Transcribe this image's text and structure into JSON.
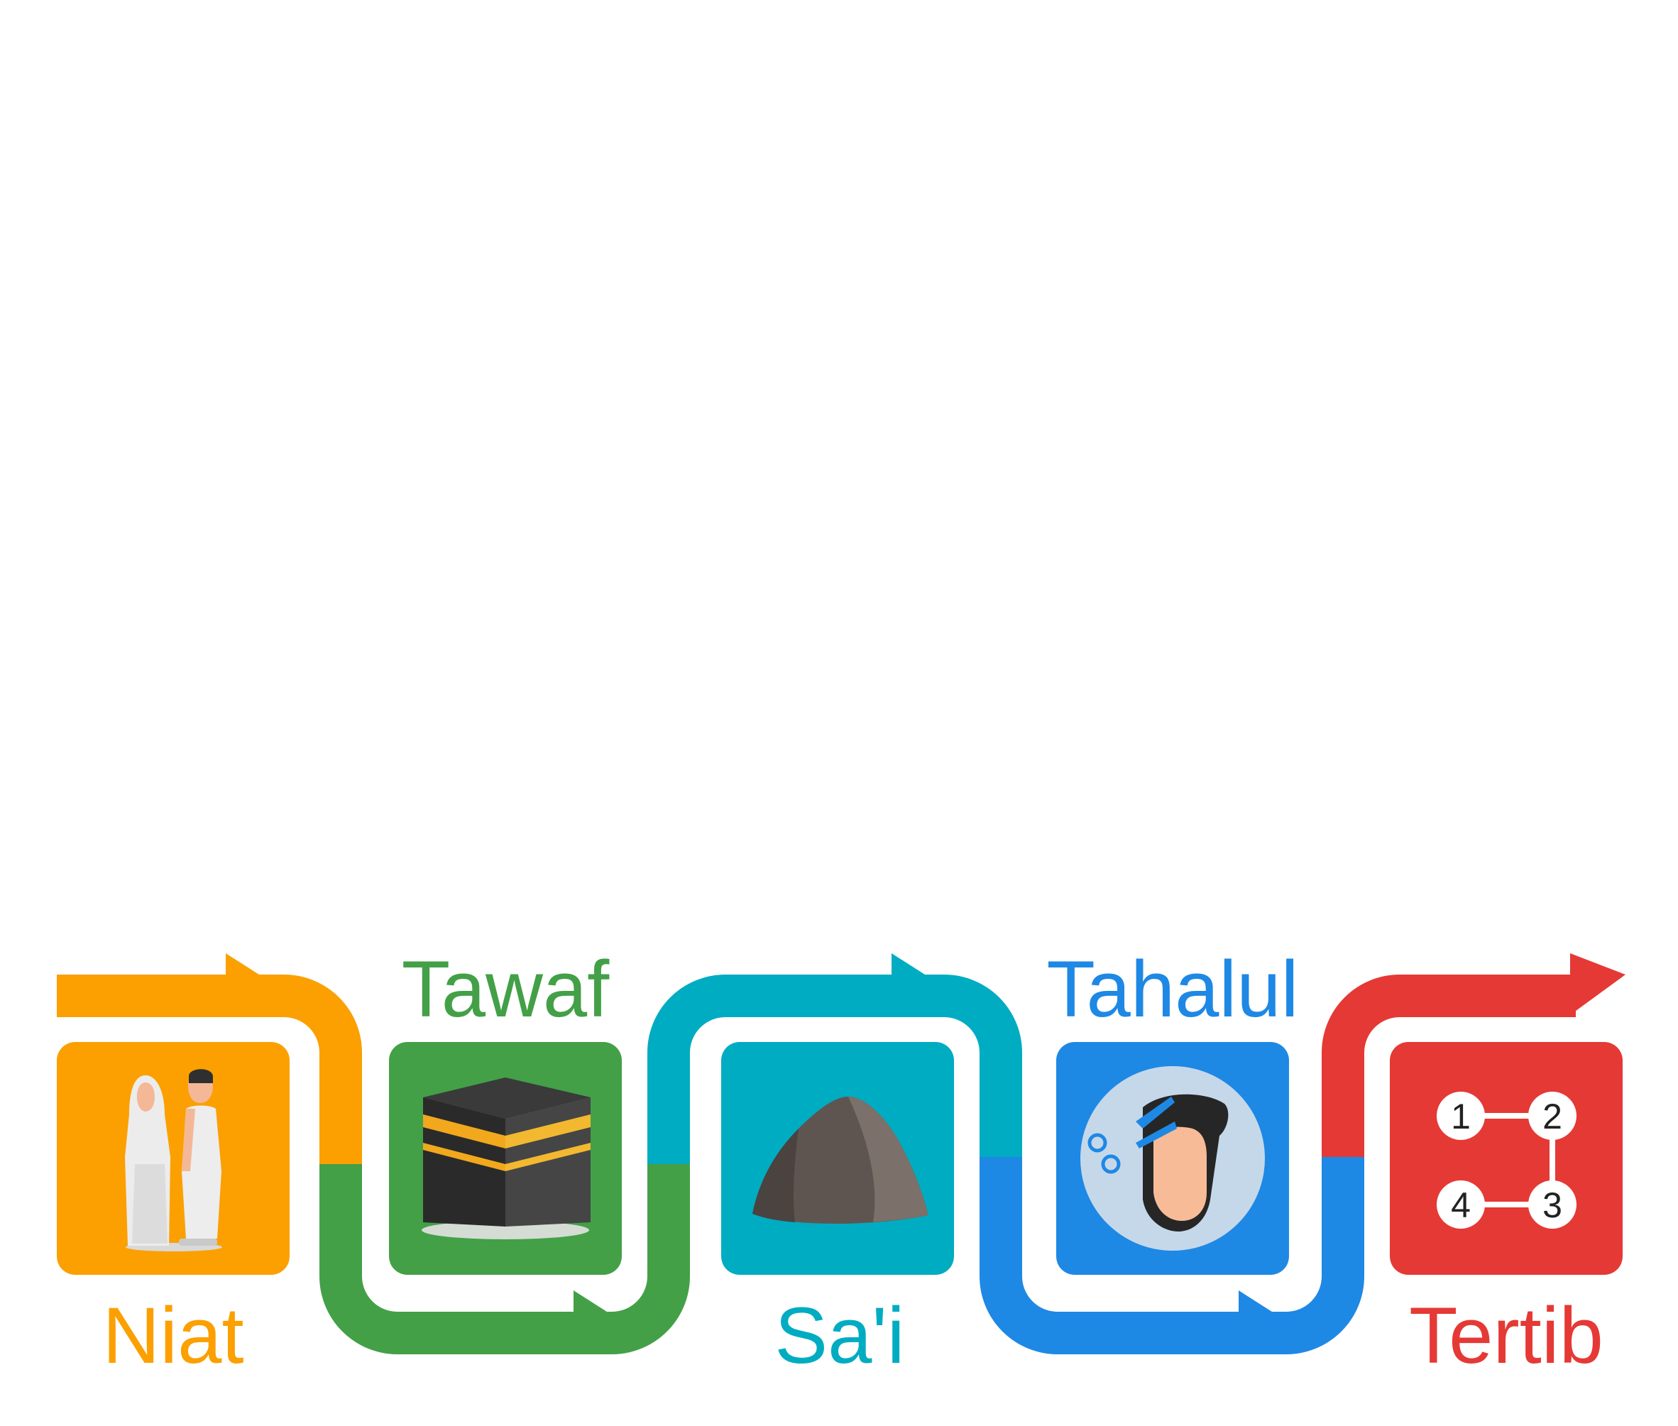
{
  "steps": [
    {
      "label": "Niat",
      "color": "#FBA000",
      "icon": "pilgrims-ihram-icon"
    },
    {
      "label": "Tawaf",
      "color": "#43A047",
      "icon": "kaaba-icon"
    },
    {
      "label": "Sa'i",
      "color": "#00ACC1",
      "icon": "rock-icon"
    },
    {
      "label": "Tahalul",
      "color": "#1E88E5",
      "icon": "hair-cutting-scissors-icon"
    },
    {
      "label": "Tertib",
      "color": "#E53935",
      "icon": "ordered-sequence-icon"
    }
  ],
  "order_numbers": [
    "1",
    "2",
    "3",
    "4"
  ]
}
